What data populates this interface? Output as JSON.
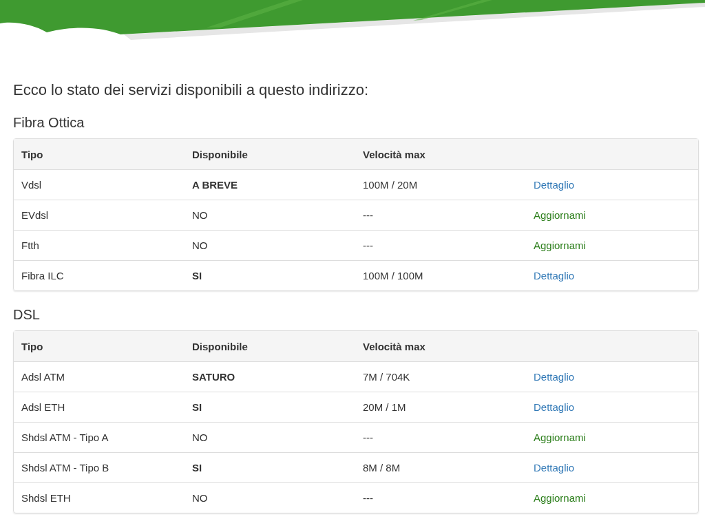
{
  "intro": "Ecco lo stato dei servizi disponibili a questo indirizzo:",
  "sections": [
    {
      "title": "Fibra Ottica",
      "columns": [
        "Tipo",
        "Disponibile",
        "Velocità max"
      ],
      "rows": [
        {
          "type": "Vdsl",
          "available": "A BREVE",
          "emphasis": true,
          "speed": "100M / 20M",
          "action": {
            "label": "Dettaglio",
            "kind": "detail"
          }
        },
        {
          "type": "EVdsl",
          "available": "NO",
          "emphasis": false,
          "speed": "---",
          "action": {
            "label": "Aggiornami",
            "kind": "update"
          }
        },
        {
          "type": "Ftth",
          "available": "NO",
          "emphasis": false,
          "speed": "---",
          "action": {
            "label": "Aggiornami",
            "kind": "update"
          }
        },
        {
          "type": "Fibra ILC",
          "available": "SI",
          "emphasis": true,
          "speed": "100M / 100M",
          "action": {
            "label": "Dettaglio",
            "kind": "detail"
          }
        }
      ]
    },
    {
      "title": "DSL",
      "columns": [
        "Tipo",
        "Disponibile",
        "Velocità max"
      ],
      "rows": [
        {
          "type": "Adsl ATM",
          "available": "SATURO",
          "emphasis": true,
          "speed": "7M / 704K",
          "action": {
            "label": "Dettaglio",
            "kind": "detail"
          }
        },
        {
          "type": "Adsl ETH",
          "available": "SI",
          "emphasis": true,
          "speed": "20M / 1M",
          "action": {
            "label": "Dettaglio",
            "kind": "detail"
          }
        },
        {
          "type": "Shdsl ATM - Tipo A",
          "available": "NO",
          "emphasis": false,
          "speed": "---",
          "action": {
            "label": "Aggiornami",
            "kind": "update"
          }
        },
        {
          "type": "Shdsl ATM - Tipo B",
          "available": "SI",
          "emphasis": true,
          "speed": "8M / 8M",
          "action": {
            "label": "Dettaglio",
            "kind": "detail"
          }
        },
        {
          "type": "Shdsl ETH",
          "available": "NO",
          "emphasis": false,
          "speed": "---",
          "action": {
            "label": "Aggiornami",
            "kind": "update"
          }
        }
      ]
    }
  ]
}
